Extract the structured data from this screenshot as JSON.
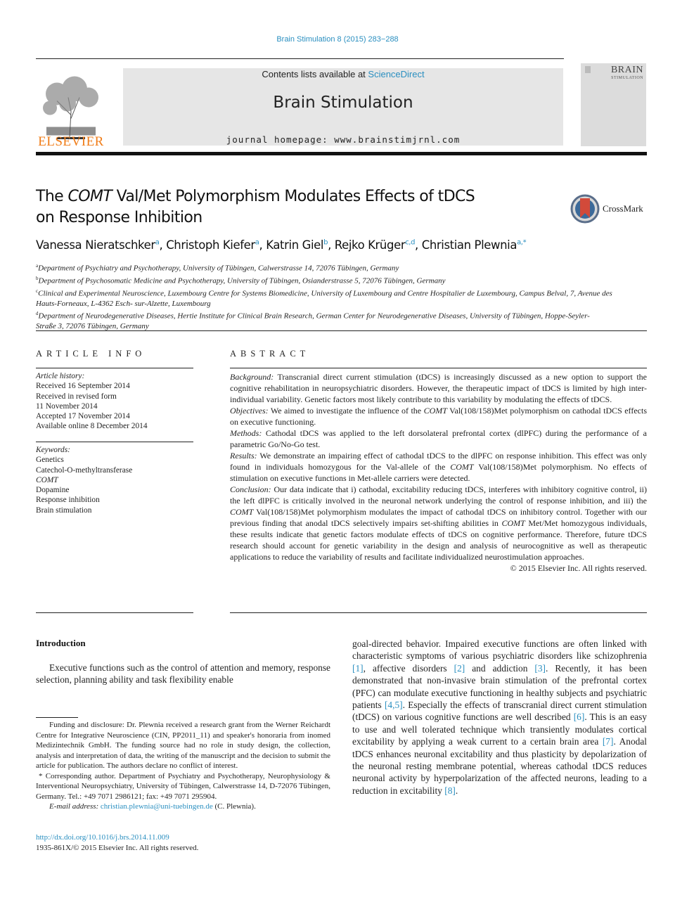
{
  "header": {
    "citation": "Brain Stimulation 8 (2015) 283−288",
    "publisher_logo_text": "ELSEVIER",
    "contents_prefix": "Contents lists available at ",
    "contents_link": "ScienceDirect",
    "journal_title": "Brain Stimulation",
    "homepage": "journal homepage: www.brainstimjrnl.com",
    "cover_title_line1": "BRAIN",
    "cover_title_line2": "STIMULATION",
    "crossmark_label": "CrossMark",
    "colors": {
      "link": "#2a8fc0",
      "elsevier_orange": "#f07d19",
      "masthead_bg": "#e6e6e6"
    }
  },
  "article": {
    "title_part1": "The ",
    "title_italic": "COMT",
    "title_part2": " Val/Met Polymorphism Modulates Effects of tDCS",
    "title_line2": "on Response Inhibition",
    "authors": [
      {
        "name": "Vanessa Nieratschker",
        "sup": "a"
      },
      {
        "name": "Christoph Kiefer",
        "sup": "a"
      },
      {
        "name": "Katrin Giel",
        "sup": "b"
      },
      {
        "name": "Rejko Krüger",
        "sup": "c,d"
      },
      {
        "name": "Christian Plewnia",
        "sup": "a,*"
      }
    ],
    "affiliations": [
      {
        "key": "a",
        "text": "Department of Psychiatry and Psychotherapy, University of Tübingen, Calwerstrasse 14, 72076 Tübingen, Germany"
      },
      {
        "key": "b",
        "text": "Department of Psychosomatic Medicine and Psychotherapy, University of Tübingen, Osianderstrasse 5, 72076 Tübingen, Germany"
      },
      {
        "key": "c",
        "text": "Clinical and Experimental Neuroscience, Luxembourg Centre for Systems Biomedicine, University of Luxembourg and Centre Hospitalier de Luxembourg, Campus Belval, 7, Avenue des Hauts-Forneaux, L-4362 Esch- sur-Alzette, Luxembourg"
      },
      {
        "key": "d",
        "text": "Department of Neurodegenerative Diseases, Hertie Institute for Clinical Brain Research, German Center for Neurodegenerative Diseases, University of Tübingen, Hoppe-Seyler-Straße 3, 72076 Tübingen, Germany"
      }
    ]
  },
  "article_info": {
    "heading": "ARTICLE INFO",
    "history_label": "Article history:",
    "history": [
      "Received 16 September 2014",
      "Received in revised form",
      "11 November 2014",
      "Accepted 17 November 2014",
      "Available online 8 December 2014"
    ],
    "keywords_label": "Keywords:",
    "keywords": [
      "Genetics",
      "Catechol-O-methyltransferase",
      "COMT",
      "Dopamine",
      "Response inhibition",
      "Brain stimulation"
    ]
  },
  "abstract": {
    "heading": "ABSTRACT",
    "background_label": "Background:",
    "background": " Transcranial direct current stimulation (tDCS) is increasingly discussed as a new option to support the cognitive rehabilitation in neuropsychiatric disorders. However, the therapeutic impact of tDCS is limited by high inter-individual variability. Genetic factors most likely contribute to this variability by modulating the effects of tDCS.",
    "objectives_label": "Objectives:",
    "objectives_a": " We aimed to investigate the influence of the ",
    "objectives_italic": "COMT",
    "objectives_b": " Val(108/158)Met polymorphism on cathodal tDCS effects on executive functioning.",
    "methods_label": "Methods:",
    "methods": " Cathodal tDCS was applied to the left dorsolateral prefrontal cortex (dlPFC) during the performance of a parametric Go/No-Go test.",
    "results_label": "Results:",
    "results_a": " We demonstrate an impairing effect of cathodal tDCS to the dlPFC on response inhibition. This effect was only found in individuals homozygous for the Val-allele of the ",
    "results_italic": "COMT",
    "results_b": " Val(108/158)Met polymorphism. No effects of stimulation on executive functions in Met-allele carriers were detected.",
    "conclusion_label": "Conclusion:",
    "conclusion_a": " Our data indicate that i) cathodal, excitability reducing tDCS, interferes with inhibitory cognitive control, ii) the left dlPFC is critically involved in the neuronal network underlying the control of response inhibition, and iii) the ",
    "conclusion_italic1": "COMT",
    "conclusion_b": " Val(108/158)Met polymorphism modulates the impact of cathodal tDCS on inhibitory control. Together with our previous finding that anodal tDCS selectively impairs set-shifting abilities in ",
    "conclusion_italic2": "COMT",
    "conclusion_c": " Met/Met homozygous individuals, these results indicate that genetic factors modulate effects of tDCS on cognitive performance. Therefore, future tDCS research should account for genetic variability in the design and analysis of neurocognitive as well as therapeutic applications to reduce the variability of results and facilitate individualized neurostimulation approaches.",
    "copyright": "© 2015 Elsevier Inc. All rights reserved."
  },
  "introduction": {
    "heading": "Introduction",
    "left_text": "Executive functions such as the control of attention and memory, response selection, planning ability and task flexibility enable",
    "right_segments": [
      {
        "t": "goal-directed behavior. Impaired executive functions are often linked with characteristic symptoms of various psychiatric disorders like schizophrenia "
      },
      {
        "ref": "[1]"
      },
      {
        "t": ", affective disorders "
      },
      {
        "ref": "[2]"
      },
      {
        "t": " and addiction "
      },
      {
        "ref": "[3]"
      },
      {
        "t": ". Recently, it has been demonstrated that non-invasive brain stimulation of the prefrontal cortex (PFC) can modulate executive functioning in healthy subjects and psychiatric patients "
      },
      {
        "ref": "[4,5]"
      },
      {
        "t": ". Especially the effects of transcranial direct current stimulation (tDCS) on various cognitive functions are well described "
      },
      {
        "ref": "[6]"
      },
      {
        "t": ". This is an easy to use and well tolerated technique which transiently modulates cortical excitability by applying a weak current to a certain brain area "
      },
      {
        "ref": "[7]"
      },
      {
        "t": ". Anodal tDCS enhances neuronal excitability and thus plasticity by depolarization of the neuronal resting membrane potential, whereas cathodal tDCS reduces neuronal activity by hyperpolarization of the affected neurons, leading to a reduction in excitability "
      },
      {
        "ref": "[8]"
      },
      {
        "t": "."
      }
    ]
  },
  "footnotes": {
    "funding": "Funding and disclosure: Dr. Plewnia received a research grant from the Werner Reichardt Centre for Integrative Neuroscience (CIN, PP2011_11) and speaker's honoraria from inomed Medizintechnik GmbH. The funding source had no role in study design, the collection, analysis and interpretation of data, the writing of the manuscript and the decision to submit the article for publication. The authors declare no conflict of interest.",
    "corresponding": "* Corresponding author. Department of Psychiatry and Psychotherapy, Neurophysiology & Interventional Neuropsychiatry, University of Tübingen, Calwerstrasse 14, D-72076 Tübingen, Germany. Tel.: +49 7071 2986121; fax: +49 7071 295904.",
    "email_label": "E-mail address:",
    "email": "christian.plewnia@uni-tuebingen.de",
    "email_suffix": " (C. Plewnia).",
    "doi": "http://dx.doi.org/10.1016/j.brs.2014.11.009",
    "issn": "1935-861X/© 2015 Elsevier Inc. All rights reserved."
  }
}
